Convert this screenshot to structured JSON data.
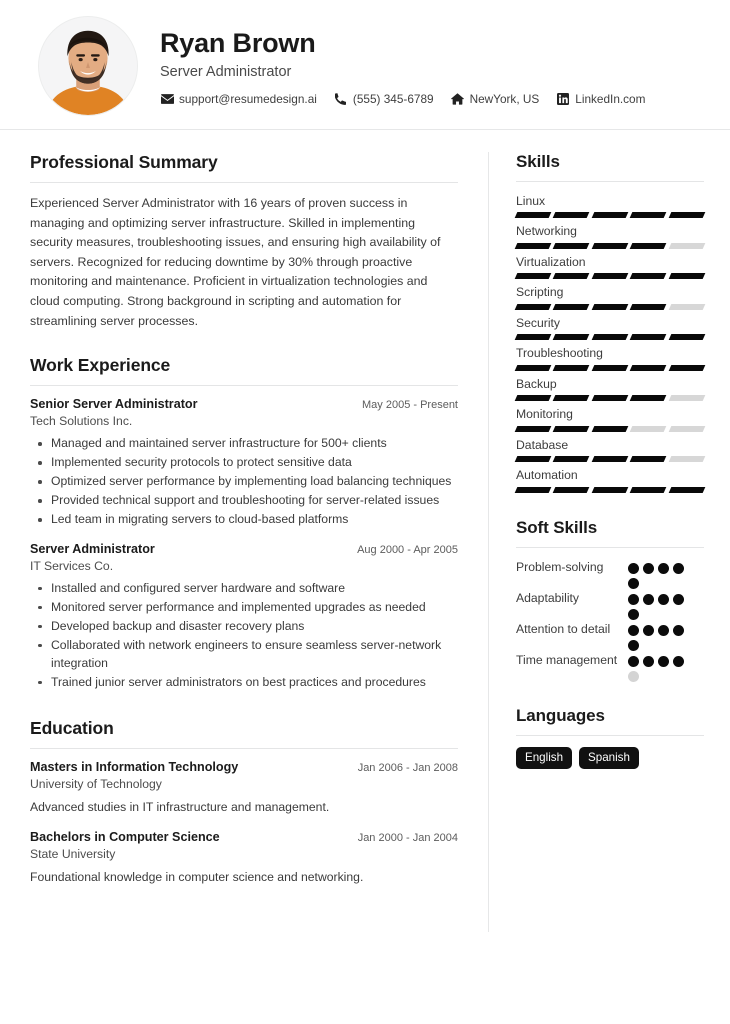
{
  "header": {
    "name": "Ryan Brown",
    "job_title": "Server Administrator",
    "avatar_alt": "profile-photo",
    "contacts": [
      {
        "icon": "envelope-icon",
        "label": "support@resumedesign.ai",
        "name": "email"
      },
      {
        "icon": "phone-icon",
        "label": "(555) 345-6789",
        "name": "phone"
      },
      {
        "icon": "home-icon",
        "label": "NewYork, US",
        "name": "location"
      },
      {
        "icon": "linkedin-icon",
        "label": "LinkedIn.com",
        "name": "linkedin"
      }
    ]
  },
  "main": {
    "summary": {
      "title": "Professional Summary",
      "text": "Experienced Server Administrator with 16 years of proven success in managing and optimizing server infrastructure. Skilled in implementing security measures, troubleshooting issues, and ensuring high availability of servers. Recognized for reducing downtime by 30% through proactive monitoring and maintenance. Proficient in virtualization technologies and cloud computing. Strong background in scripting and automation for streamlining server processes."
    },
    "experience": {
      "title": "Work Experience",
      "entries": [
        {
          "role": "Senior Server Administrator",
          "date": "May 2005 - Present",
          "company": "Tech Solutions Inc.",
          "bullets": [
            "Managed and maintained server infrastructure for 500+ clients",
            "Implemented security protocols to protect sensitive data",
            "Optimized server performance by implementing load balancing techniques",
            "Provided technical support and troubleshooting for server-related issues",
            "Led team in migrating servers to cloud-based platforms"
          ]
        },
        {
          "role": "Server Administrator",
          "date": "Aug 2000 - Apr 2005",
          "company": "IT Services Co.",
          "bullets": [
            "Installed and configured server hardware and software",
            "Monitored server performance and implemented upgrades as needed",
            "Developed backup and disaster recovery plans",
            "Collaborated with network engineers to ensure seamless server-network integration",
            "Trained junior server administrators on best practices and procedures"
          ]
        }
      ]
    },
    "education": {
      "title": "Education",
      "entries": [
        {
          "degree": "Masters in Information Technology",
          "date": "Jan 2006 - Jan 2008",
          "school": "University of Technology",
          "description": "Advanced studies in IT infrastructure and management."
        },
        {
          "degree": "Bachelors in Computer Science",
          "date": "Jan 2000 - Jan 2004",
          "school": "State University",
          "description": "Foundational knowledge in computer science and networking."
        }
      ]
    }
  },
  "sidebar": {
    "skills": {
      "title": "Skills",
      "max": 5,
      "items": [
        {
          "label": "Linux",
          "level": 5
        },
        {
          "label": "Networking",
          "level": 4
        },
        {
          "label": "Virtualization",
          "level": 5
        },
        {
          "label": "Scripting",
          "level": 4
        },
        {
          "label": "Security",
          "level": 5
        },
        {
          "label": "Troubleshooting",
          "level": 5
        },
        {
          "label": "Backup",
          "level": 4
        },
        {
          "label": "Monitoring",
          "level": 3
        },
        {
          "label": "Database",
          "level": 4
        },
        {
          "label": "Automation",
          "level": 5
        }
      ]
    },
    "soft_skills": {
      "title": "Soft Skills",
      "max": 5,
      "items": [
        {
          "label": "Problem-solving",
          "level": 5
        },
        {
          "label": "Adaptability",
          "level": 5
        },
        {
          "label": "Attention to detail",
          "level": 5
        },
        {
          "label": "Time management",
          "level": 4
        }
      ]
    },
    "languages": {
      "title": "Languages",
      "items": [
        "English",
        "Spanish"
      ]
    }
  },
  "colors": {
    "accent": "#0b0b0b",
    "muted_bar": "#d7d7d7",
    "rule": "#e4e5e6",
    "text": "#3b3b3b",
    "heading": "#1b1b1b",
    "shirt": "#e08324"
  }
}
